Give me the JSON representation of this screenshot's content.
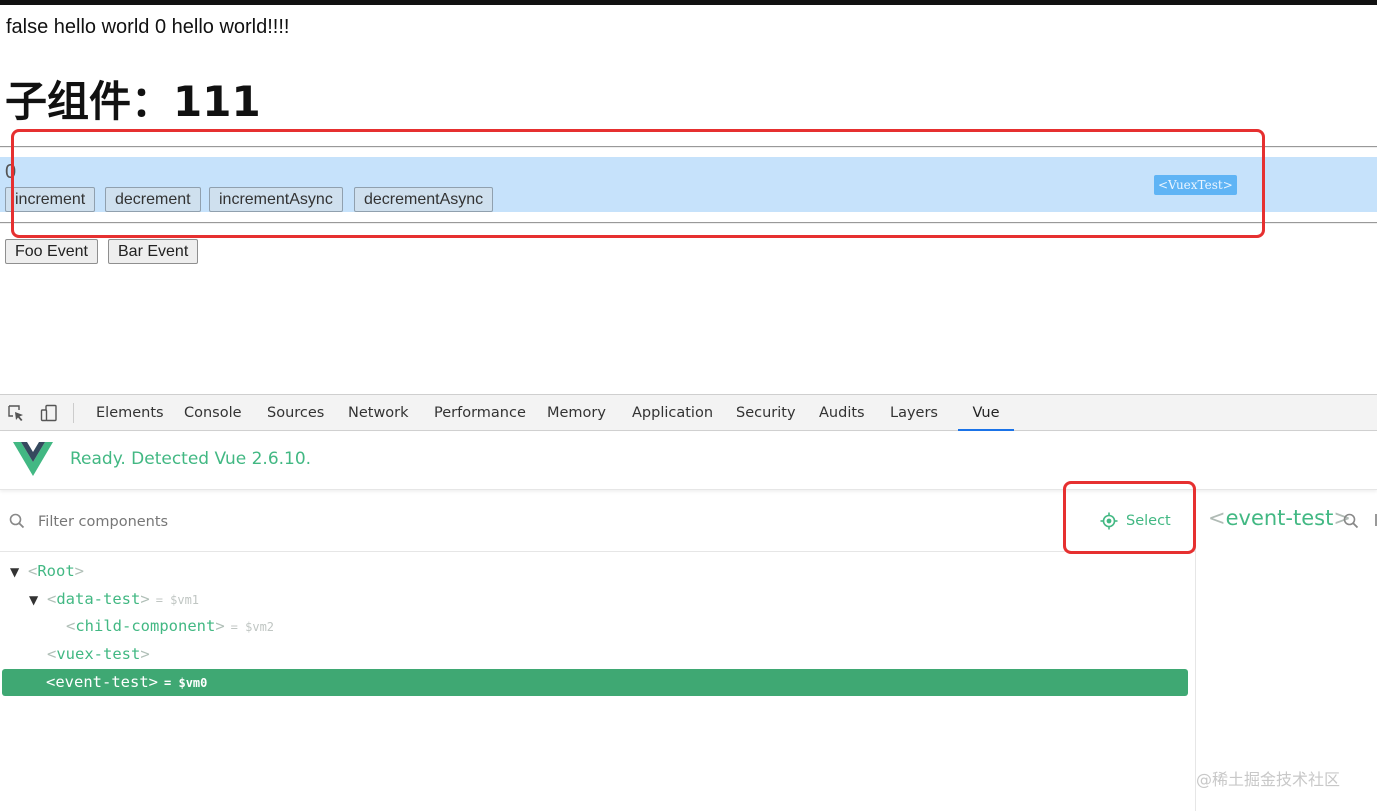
{
  "page": {
    "top_line": "false hello world 0 hello world!!!!",
    "heading": "子组件：111",
    "counter_value": "0",
    "vuex_buttons": [
      "increment",
      "decrement",
      "incrementAsync",
      "decrementAsync"
    ],
    "component_tag": "<VuexTest>",
    "event_buttons": [
      "Foo Event",
      "Bar Event"
    ]
  },
  "devtools": {
    "tabs": [
      "Elements",
      "Console",
      "Sources",
      "Network",
      "Performance",
      "Memory",
      "Application",
      "Security",
      "Audits",
      "Layers",
      "Vue"
    ],
    "active_tab": "Vue",
    "inspect_icon": "inspect-element-icon",
    "device_icon": "device-toggle-icon"
  },
  "vue_panel": {
    "status": "Ready. Detected Vue 2.6.10.",
    "logo": "vue-logo-icon",
    "filter_placeholder": "Filter components",
    "select_label": "Select",
    "selected_component": "event-test",
    "tree": [
      {
        "name": "Root",
        "vm": "",
        "expanded": true,
        "depth": 0
      },
      {
        "name": "data-test",
        "vm": "= $vm1",
        "expanded": true,
        "depth": 1
      },
      {
        "name": "child-component",
        "vm": "= $vm2",
        "expanded": null,
        "depth": 2
      },
      {
        "name": "vuex-test",
        "vm": "",
        "expanded": null,
        "depth": 1
      },
      {
        "name": "event-test",
        "vm": "= $vm0",
        "expanded": null,
        "depth": 1,
        "selected": true
      }
    ]
  },
  "watermark": "@稀土掘金技术社区",
  "colors": {
    "vue_green": "#42b883",
    "selected_row": "#3fa873",
    "highlight": "#c6e2fb",
    "annotation_red": "#e63030"
  }
}
